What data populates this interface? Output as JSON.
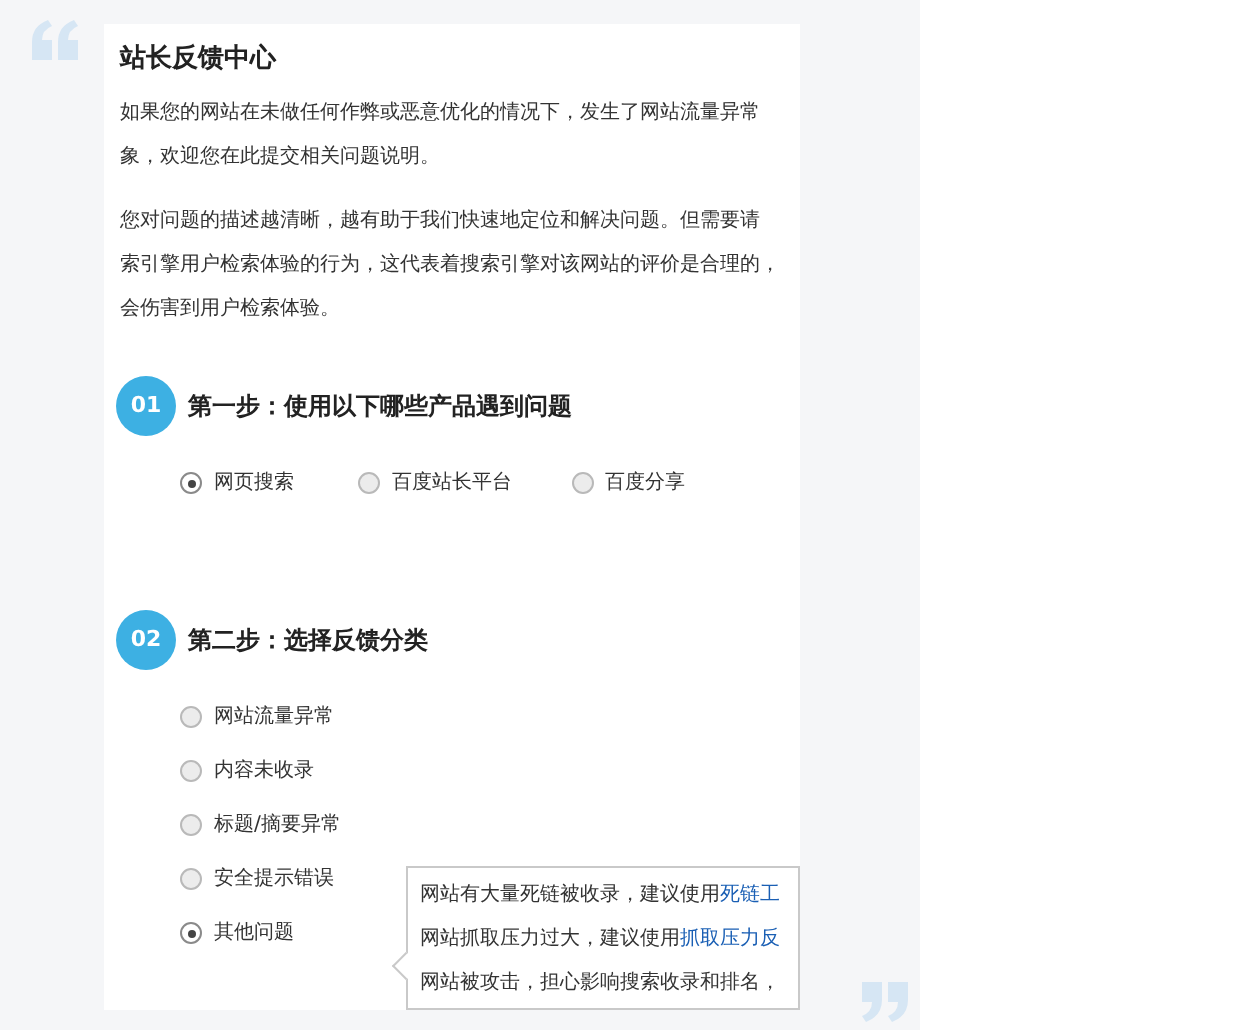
{
  "title": "站长反馈中心",
  "paragraphs": [
    [
      "如果您的网站在未做任何作弊或恶意优化的情况下，发生了网站流量异常",
      "象，欢迎您在此提交相关问题说明。"
    ],
    [
      "您对问题的描述越清晰，越有助于我们快速地定位和解决问题。但需要请",
      "索引擎用户检索体验的行为，这代表着搜索引擎对该网站的评价是合理的，",
      "会伤害到用户检索体验。"
    ]
  ],
  "steps": [
    {
      "number": "01",
      "heading": "第一步：使用以下哪些产品遇到问题",
      "kind": "row",
      "options": [
        {
          "label": "网页搜索",
          "selected": true
        },
        {
          "label": "百度站长平台",
          "selected": false
        },
        {
          "label": "百度分享",
          "selected": false
        }
      ]
    },
    {
      "number": "02",
      "heading": "第二步：选择反馈分类",
      "kind": "column",
      "options": [
        {
          "label": "网站流量异常",
          "selected": false
        },
        {
          "label": "内容未收录",
          "selected": false
        },
        {
          "label": "标题/摘要异常",
          "selected": false
        },
        {
          "label": "安全提示错误",
          "selected": false
        },
        {
          "label": "其他问题",
          "selected": true
        }
      ]
    }
  ],
  "tooltip": {
    "lines": [
      {
        "text": "网站有大量死链被收录，建议使用",
        "link": "死链工"
      },
      {
        "text": "网站抓取压力过大，建议使用",
        "link": "抓取压力反"
      },
      {
        "text": "网站被攻击，担心影响搜索收录和排名，"
      }
    ]
  }
}
